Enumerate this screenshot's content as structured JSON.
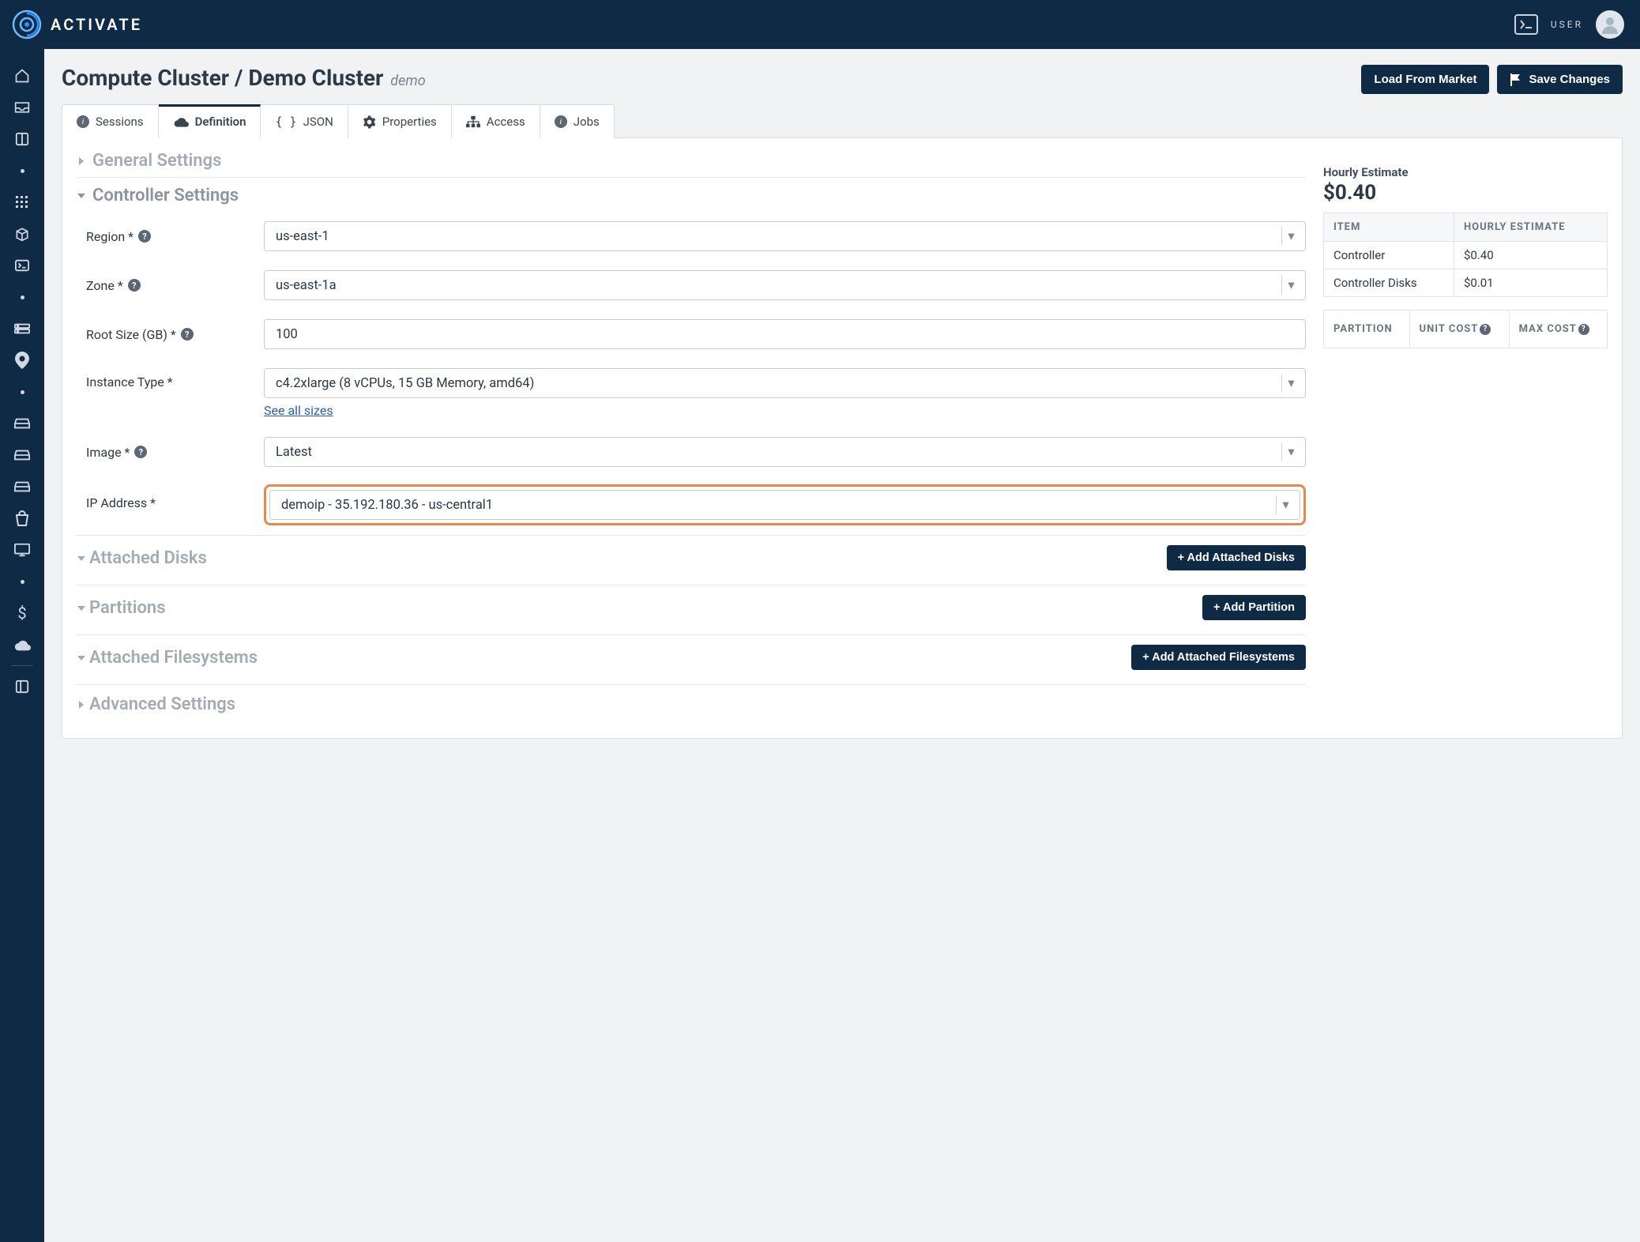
{
  "brand": {
    "name": "ACTIVATE"
  },
  "user": {
    "label": "USER"
  },
  "breadcrumb": {
    "section": "Compute Cluster",
    "name": "Demo Cluster",
    "slug": "demo"
  },
  "header_buttons": {
    "load_market": "Load From Market",
    "save": "Save Changes"
  },
  "tabs": {
    "sessions": "Sessions",
    "definition": "Definition",
    "json": "JSON",
    "properties": "Properties",
    "access": "Access",
    "jobs": "Jobs"
  },
  "sections": {
    "general": "General Settings",
    "controller": "Controller Settings",
    "attached_disks": "Attached Disks",
    "partitions": "Partitions",
    "attached_fs": "Attached Filesystems",
    "advanced": "Advanced Settings"
  },
  "form": {
    "region": {
      "label": "Region *",
      "value": "us-east-1"
    },
    "zone": {
      "label": "Zone *",
      "value": "us-east-1a"
    },
    "root_size": {
      "label": "Root Size (GB) *",
      "value": "100"
    },
    "instance_type": {
      "label": "Instance Type *",
      "value": "c4.2xlarge (8 vCPUs, 15 GB Memory, amd64)",
      "link": "See all sizes"
    },
    "image": {
      "label": "Image *",
      "value": "Latest"
    },
    "ip": {
      "label": "IP Address *",
      "value": "demoip - 35.192.180.36 - us-central1"
    }
  },
  "buttons": {
    "add_disks": "+ Add Attached Disks",
    "add_partition": "+ Add Partition",
    "add_fs": "+ Add Attached Filesystems"
  },
  "estimate": {
    "title": "Hourly Estimate",
    "total": "$0.40",
    "cols": {
      "item": "ITEM",
      "hourly": "HOURLY ESTIMATE"
    },
    "rows": [
      {
        "item": "Controller",
        "hourly": "$0.40"
      },
      {
        "item": "Controller Disks",
        "hourly": "$0.01"
      }
    ],
    "cols2": {
      "partition": "PARTITION",
      "unit": "UNIT COST",
      "max": "MAX COST"
    }
  }
}
